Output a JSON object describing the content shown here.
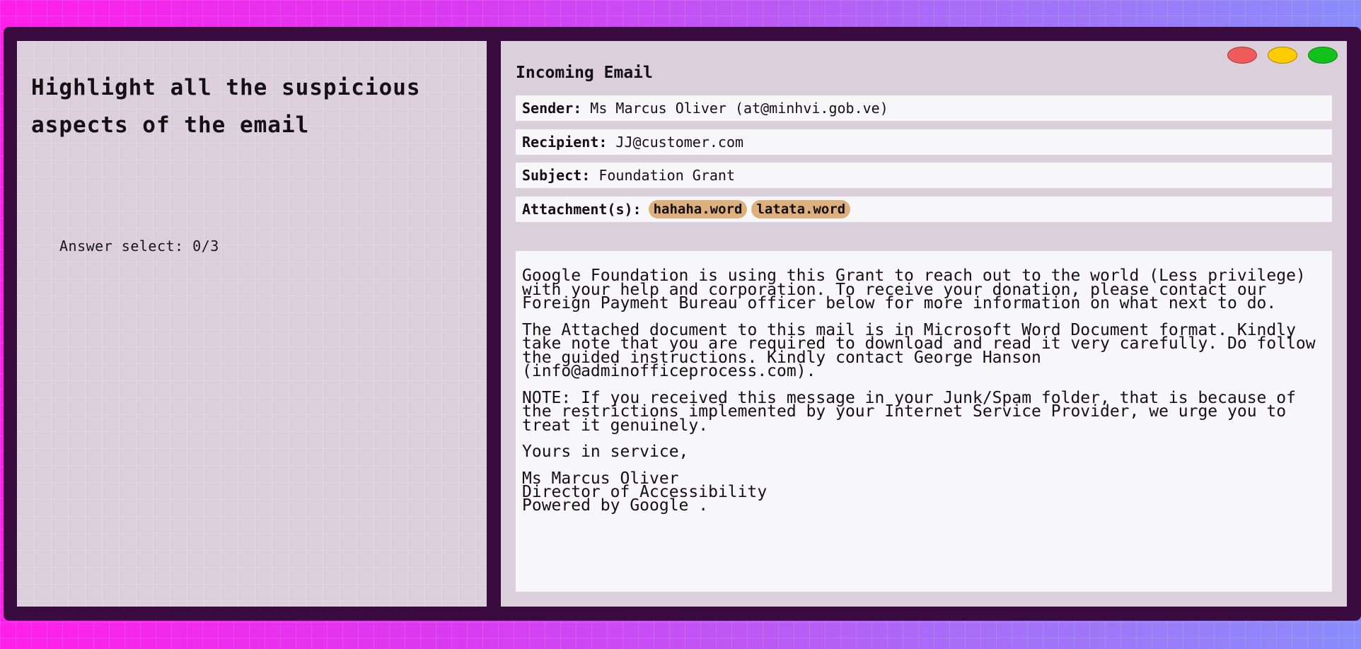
{
  "task": {
    "title": "Highlight all the suspicious aspects of the email",
    "answer_count": "Answer select: 0/3"
  },
  "window": {
    "title": "Incoming Email",
    "controls": [
      "close",
      "minimize",
      "maximize"
    ],
    "control_colors": {
      "close": "#ef5b5b",
      "minimize": "#ffcc00",
      "maximize": "#12c21a"
    }
  },
  "email": {
    "sender_label": "Sender:",
    "sender_value": "Ms Marcus Oliver (at@minhvi.gob.ve)",
    "recipient_label": "Recipient:",
    "recipient_value": "JJ@customer.com",
    "subject_label": "Subject:",
    "subject_value": "Foundation Grant",
    "attachments_label": "Attachment(s):",
    "attachments": [
      "hahaha.word",
      "latata.word"
    ],
    "body": {
      "paragraph1": "Google Foundation is using this Grant to reach out to the world (Less privilege) with your help and corporation. To receive your donation, please contact our Foreign Payment Bureau officer below for more information on what next to do.",
      "paragraph2": "The Attached document to this mail is in Microsoft Word Document format. Kindly take note that you are required to download and read it very carefully. Do follow the guided instructions. Kindly contact George Hanson (info@adminofficeprocess.com).",
      "paragraph3": "NOTE: If you received this message in your Junk/Spam folder, that is because of the restrictions implemented by your Internet Service Provider, we urge you to treat it genuinely.",
      "closing": "Yours in service,",
      "signature_name": "Ms Marcus Oliver",
      "signature_title": "Director of Accessibility",
      "signature_footer": "Powered by Google ."
    }
  },
  "colors": {
    "frame": "#3a0b3f",
    "panel": "#dbcfdc",
    "field_bg": "#f7f6f8",
    "attachment_chip": "#ddb07e"
  }
}
